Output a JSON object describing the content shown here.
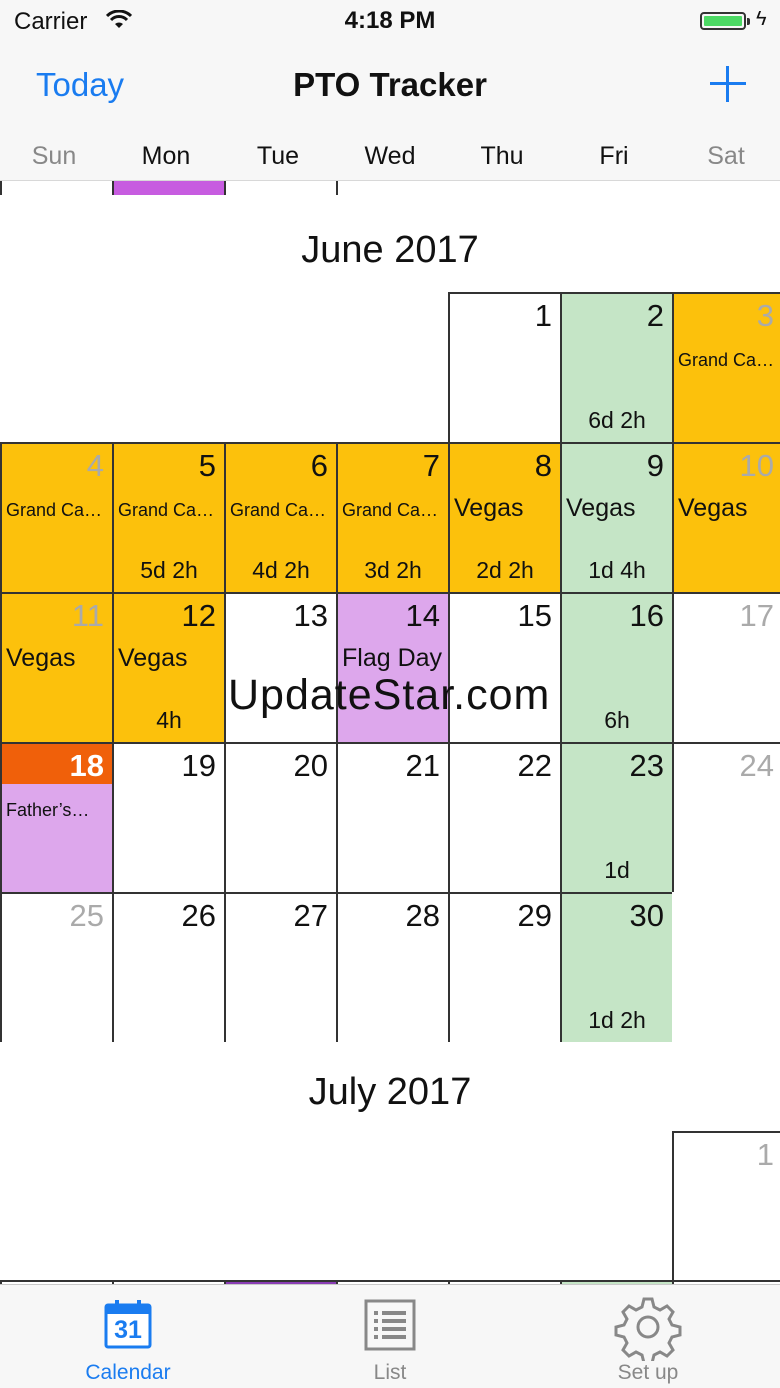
{
  "status_bar": {
    "carrier": "Carrier",
    "time": "4:18 PM"
  },
  "nav": {
    "today_label": "Today",
    "title": "PTO Tracker"
  },
  "weekdays": [
    "Sun",
    "Mon",
    "Tue",
    "Wed",
    "Thu",
    "Fri",
    "Sat"
  ],
  "colors": {
    "vacation": "#fcc10c",
    "holiday": "#dda7ec",
    "payday": "#c5e5c6",
    "today": "#f0600a",
    "accent": "#1a7cf0"
  },
  "months": [
    {
      "title": "June 2017",
      "days": [
        {
          "d": "1",
          "weekday": 4
        },
        {
          "d": "2",
          "weekday": 5,
          "type": "payday",
          "bal": "6d 2h"
        },
        {
          "d": "3",
          "weekday": 6,
          "type": "vacation",
          "ev": "Grand Ca…",
          "small": true
        },
        {
          "d": "4",
          "weekday": 0,
          "type": "vacation",
          "ev": "Grand Ca…",
          "small": true
        },
        {
          "d": "5",
          "weekday": 1,
          "type": "vacation",
          "ev": "Grand Ca…",
          "small": true,
          "bal": "5d 2h"
        },
        {
          "d": "6",
          "weekday": 2,
          "type": "vacation",
          "ev": "Grand Ca…",
          "small": true,
          "bal": "4d 2h"
        },
        {
          "d": "7",
          "weekday": 3,
          "type": "vacation",
          "ev": "Grand Ca…",
          "small": true,
          "bal": "3d 2h"
        },
        {
          "d": "8",
          "weekday": 4,
          "type": "vacation",
          "ev": "Vegas",
          "bal": "2d 2h"
        },
        {
          "d": "9",
          "weekday": 5,
          "type": "payday",
          "ev": "Vegas",
          "bal": "1d 4h"
        },
        {
          "d": "10",
          "weekday": 6,
          "type": "vacation",
          "ev": "Vegas"
        },
        {
          "d": "11",
          "weekday": 0,
          "type": "vacation",
          "ev": "Vegas"
        },
        {
          "d": "12",
          "weekday": 1,
          "type": "vacation",
          "ev": "Vegas",
          "bal": "4h"
        },
        {
          "d": "13",
          "weekday": 2
        },
        {
          "d": "14",
          "weekday": 3,
          "type": "holiday",
          "ev": "Flag Day"
        },
        {
          "d": "15",
          "weekday": 4
        },
        {
          "d": "16",
          "weekday": 5,
          "type": "payday",
          "bal": "6h"
        },
        {
          "d": "17",
          "weekday": 6
        },
        {
          "d": "18",
          "weekday": 0,
          "type": "holiday",
          "ev": "Father’s…",
          "small": true,
          "today": true
        },
        {
          "d": "19",
          "weekday": 1
        },
        {
          "d": "20",
          "weekday": 2
        },
        {
          "d": "21",
          "weekday": 3
        },
        {
          "d": "22",
          "weekday": 4
        },
        {
          "d": "23",
          "weekday": 5,
          "type": "payday",
          "bal": "1d"
        },
        {
          "d": "24",
          "weekday": 6
        },
        {
          "d": "25",
          "weekday": 0
        },
        {
          "d": "26",
          "weekday": 1
        },
        {
          "d": "27",
          "weekday": 2
        },
        {
          "d": "28",
          "weekday": 3
        },
        {
          "d": "29",
          "weekday": 4
        },
        {
          "d": "30",
          "weekday": 5,
          "type": "payday",
          "bal": "1d 2h"
        }
      ]
    },
    {
      "title": "July 2017",
      "days": [
        {
          "d": "1",
          "weekday": 6
        }
      ]
    }
  ],
  "watermark": "UpdateStar.com",
  "tabs": [
    {
      "label": "Calendar",
      "icon": "calendar-icon",
      "badge": "31",
      "active": true
    },
    {
      "label": "List",
      "icon": "list-icon",
      "active": false
    },
    {
      "label": "Set up",
      "icon": "gear-icon",
      "active": false
    }
  ]
}
